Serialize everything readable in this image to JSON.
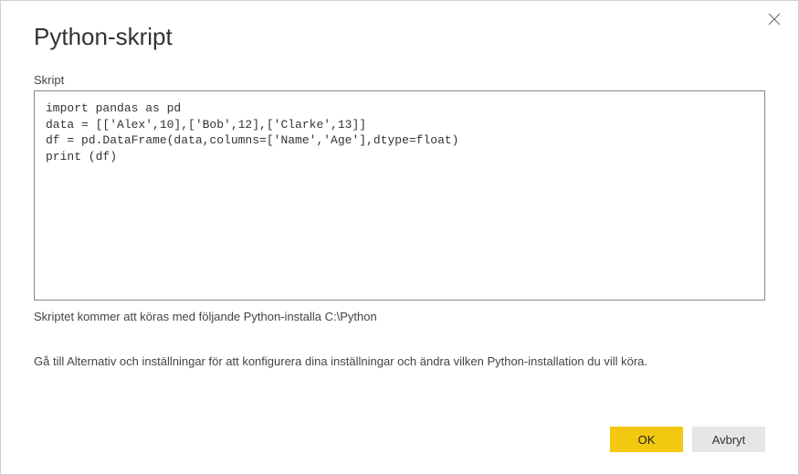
{
  "dialog": {
    "title": "Python-skript",
    "script_label": "Skript",
    "script_content": "import pandas as pd\ndata = [['Alex',10],['Bob',12],['Clarke',13]]\ndf = pd.DataFrame(data,columns=['Name','Age'],dtype=float)\nprint (df)",
    "install_info": "Skriptet kommer att köras med följande Python-installa C:\\Python",
    "help_text": "Gå till Alternativ och inställningar för att konfigurera dina inställningar och ändra vilken Python-installation du vill köra.",
    "ok_label": "OK",
    "cancel_label": "Avbryt"
  }
}
